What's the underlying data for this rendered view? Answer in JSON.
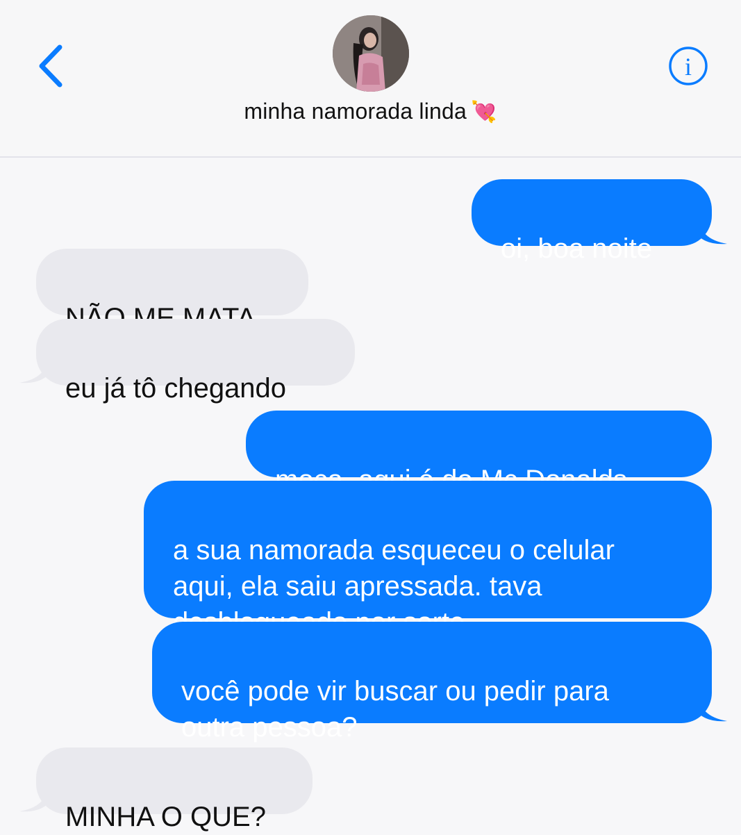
{
  "header": {
    "back_icon": "chevron-left-icon",
    "avatar_icon": "contact-photo",
    "contact_name": "minha namorada linda",
    "contact_emoji": "💘",
    "info_icon": "info-icon",
    "accent_color": "#0a7cff"
  },
  "messages": [
    {
      "direction": "sent",
      "text": "oi, boa noite"
    },
    {
      "direction": "received",
      "text": "NÃO ME MATA"
    },
    {
      "direction": "received",
      "text": "eu já tô chegando"
    },
    {
      "direction": "sent",
      "text": "moça, aqui é do Mc Donalds"
    },
    {
      "direction": "sent",
      "text": "a sua namorada esqueceu o celular\naqui, ela saiu apressada. tava\ndesbloqueado por sorte"
    },
    {
      "direction": "sent",
      "text": "você pode vir buscar ou pedir para\noutra pessoa?"
    },
    {
      "direction": "received",
      "text": "MINHA O QUE?"
    }
  ],
  "colors": {
    "sent_bubble": "#0a7cff",
    "received_bubble": "#e9e9ee",
    "background": "#f7f7f9"
  }
}
